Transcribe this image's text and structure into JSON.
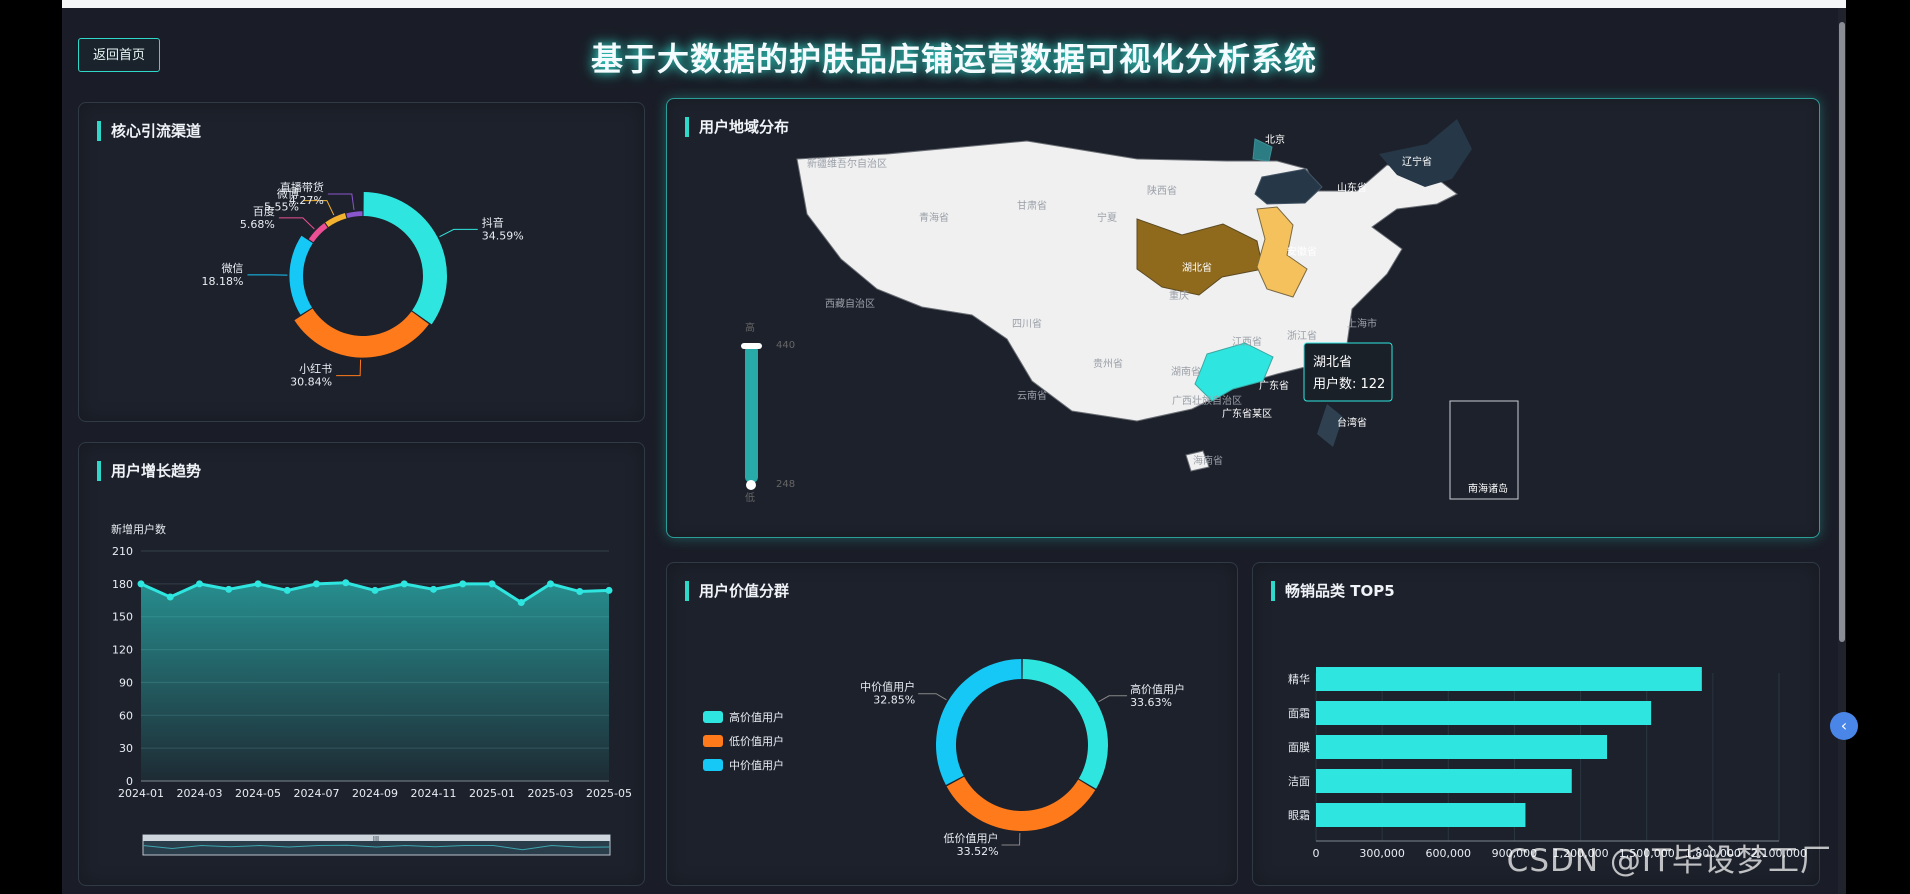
{
  "header": {
    "title": "基于大数据的护肤品店铺运营数据可视化分析系统",
    "back_button": "返回首页"
  },
  "panels": {
    "channels": "核心引流渠道",
    "growth": "用户增长趋势",
    "region": "用户地域分布",
    "value": "用户价值分群",
    "top5": "畅销品类 TOP5"
  },
  "chart_data": [
    {
      "type": "pie",
      "title": "核心引流渠道",
      "slices": [
        {
          "name": "抖音",
          "value": 34.59,
          "label": "34.59%",
          "color": "#2ee6df"
        },
        {
          "name": "小红书",
          "value": 30.84,
          "label": "30.84%",
          "color": "#ff7a1a"
        },
        {
          "name": "微信",
          "value": 18.18,
          "label": "18.18%",
          "color": "#16c8f6"
        },
        {
          "name": "百度",
          "value": 5.68,
          "label": "5.68%",
          "color": "#ec4f94"
        },
        {
          "name": "微博",
          "value": 5.55,
          "label": "5.55%",
          "color": "#f2b12e"
        },
        {
          "name": "直播带货",
          "value": 4.27,
          "label": "4.27%",
          "color": "#8a56ce"
        }
      ]
    },
    {
      "type": "area",
      "title": "用户增长趋势",
      "ylabel": "新增用户数",
      "ylim": [
        0,
        210
      ],
      "yticks": [
        0,
        30,
        60,
        90,
        120,
        150,
        180,
        210
      ],
      "x": [
        "2024-01",
        "2024-02",
        "2024-03",
        "2024-04",
        "2024-05",
        "2024-06",
        "2024-07",
        "2024-08",
        "2024-09",
        "2024-10",
        "2024-11",
        "2024-12",
        "2025-01",
        "2025-02",
        "2025-03",
        "2025-04",
        "2025-05"
      ],
      "x_ticks": [
        "2024-01",
        "2024-03",
        "2024-05",
        "2024-07",
        "2024-09",
        "2024-11",
        "2025-01",
        "2025-03",
        "2025-05"
      ],
      "series": [
        {
          "values": [
            180,
            168,
            180,
            175,
            180,
            174,
            180,
            181,
            174,
            180,
            175,
            180,
            180,
            163,
            180,
            173,
            174
          ]
        }
      ],
      "datazoom_label": "III",
      "grid": true,
      "color": "#2ee6df"
    },
    {
      "type": "map",
      "title": "用户地域分布",
      "visual_map": {
        "max_label": "440",
        "min_label": "248",
        "low_label": "低",
        "high_label": "高"
      },
      "labels": [
        "新疆维吾尔自治区",
        "辽宁省",
        "北京",
        "山东省",
        "青海省",
        "甘肃省",
        "陕西省",
        "宁夏",
        "湖北省",
        "安徽省",
        "上海市",
        "西藏自治区",
        "四川省",
        "重庆",
        "湖南省",
        "江西省",
        "浙江省",
        "贵州省",
        "云南省",
        "广西壮族自治区",
        "广东省",
        "广东省某区",
        "台湾省",
        "海南省",
        "南海诸岛"
      ],
      "highlighted": [
        {
          "name": "湖北省",
          "color": "#8f6a1c"
        },
        {
          "name": "安徽省",
          "color": "#f5c15d"
        },
        {
          "name": "广东省",
          "color": "#2ee6df"
        },
        {
          "name": "山东省",
          "color": "#263747"
        },
        {
          "name": "北京",
          "color": "#2b7d83"
        }
      ],
      "tooltip": {
        "region": "湖北省",
        "metric": "用户数",
        "value": "122"
      }
    },
    {
      "type": "pie",
      "title": "用户价值分群",
      "legend": [
        "高价值用户",
        "低价值用户",
        "中价值用户"
      ],
      "slices": [
        {
          "name": "高价值用户",
          "value": 33.63,
          "label": "33.63%",
          "color": "#2ee6df"
        },
        {
          "name": "低价值用户",
          "value": 33.52,
          "label": "33.52%",
          "color": "#ff7a1a"
        },
        {
          "name": "中价值用户",
          "value": 32.85,
          "label": "32.85%",
          "color": "#16c8f6"
        }
      ]
    },
    {
      "type": "bar",
      "title": "畅销品类 TOP5",
      "orientation": "horizontal",
      "categories": [
        "精华",
        "面霜",
        "面膜",
        "洁面",
        "眼霜"
      ],
      "values": [
        1750000,
        1520000,
        1320000,
        1160000,
        950000
      ],
      "xlim": [
        0,
        2100000
      ],
      "xticks": [
        "0",
        "300,000",
        "600,000",
        "900,000",
        "1,200,000",
        "1,500,000",
        "1,800,000",
        "2,100,000"
      ],
      "color": "#2ee6df"
    }
  ],
  "watermark": "CSDN @IT毕设梦工厂",
  "side_button": "‹"
}
